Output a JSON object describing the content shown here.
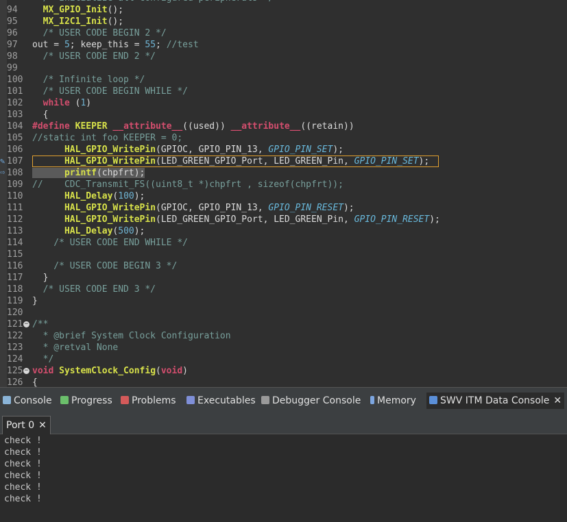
{
  "editor": {
    "lines": [
      {
        "n": "94",
        "code": "  MX_GPIO_Init();"
      },
      {
        "n": "95",
        "code": "  MX_I2C1_Init();"
      },
      {
        "n": "96",
        "code": "  /* USER CODE BEGIN 2 */"
      },
      {
        "n": "97",
        "code": "out = 5; keep_this = 55; //test"
      },
      {
        "n": "98",
        "code": "  /* USER CODE END 2 */"
      },
      {
        "n": "99",
        "code": ""
      },
      {
        "n": "100",
        "code": "  /* Infinite loop */"
      },
      {
        "n": "101",
        "code": "  /* USER CODE BEGIN WHILE */"
      },
      {
        "n": "102",
        "code": "  while (1)"
      },
      {
        "n": "103",
        "code": "  {"
      },
      {
        "n": "104",
        "code": "#define KEEPER __attribute__((used)) __attribute__((retain))"
      },
      {
        "n": "105",
        "code": "//static int foo KEEPER = 0;"
      },
      {
        "n": "106",
        "code": "      HAL_GPIO_WritePin(GPIOC, GPIO_PIN_13, GPIO_PIN_SET);"
      },
      {
        "n": "107",
        "code": "      HAL_GPIO_WritePin(LED_GREEN_GPIO_Port, LED_GREEN_Pin, GPIO_PIN_SET);"
      },
      {
        "n": "108",
        "code": "      printf(chpfrt);"
      },
      {
        "n": "109",
        "code": "//    CDC_Transmit_FS((uint8_t *)chpfrt , sizeof(chpfrt));"
      },
      {
        "n": "110",
        "code": "      HAL_Delay(100);"
      },
      {
        "n": "111",
        "code": "      HAL_GPIO_WritePin(GPIOC, GPIO_PIN_13, GPIO_PIN_RESET);"
      },
      {
        "n": "112",
        "code": "      HAL_GPIO_WritePin(LED_GREEN_GPIO_Port, LED_GREEN_Pin, GPIO_PIN_RESET);"
      },
      {
        "n": "113",
        "code": "      HAL_Delay(500);"
      },
      {
        "n": "114",
        "code": "    /* USER CODE END WHILE */"
      },
      {
        "n": "115",
        "code": ""
      },
      {
        "n": "116",
        "code": "    /* USER CODE BEGIN 3 */"
      },
      {
        "n": "117",
        "code": "  }"
      },
      {
        "n": "118",
        "code": "  /* USER CODE END 3 */"
      },
      {
        "n": "119",
        "code": "}"
      },
      {
        "n": "120",
        "code": ""
      },
      {
        "n": "121",
        "code": "/**"
      },
      {
        "n": "122",
        "code": "  * @brief System Clock Configuration"
      },
      {
        "n": "123",
        "code": "  * @retval None"
      },
      {
        "n": "124",
        "code": "  */"
      },
      {
        "n": "125",
        "code": "void SystemClock_Config(void)"
      },
      {
        "n": "126",
        "code": "{"
      }
    ],
    "top_partial": "  /* Initialize all configured peripherals */"
  },
  "tabs": [
    {
      "label": "Console",
      "icon": "console-icon"
    },
    {
      "label": "Progress",
      "icon": "progress-icon"
    },
    {
      "label": "Problems",
      "icon": "problems-icon"
    },
    {
      "label": "Executables",
      "icon": "executables-icon"
    },
    {
      "label": "Debugger Console",
      "icon": "debugger-console-icon"
    },
    {
      "label": "Memory",
      "icon": "memory-icon"
    },
    {
      "label": "SWV ITM Data Console",
      "icon": "swv-icon"
    }
  ],
  "port_tab": {
    "label": "Port 0"
  },
  "console_output": [
    "check !",
    "check !",
    "check !",
    "check !",
    "check !",
    "check !"
  ]
}
